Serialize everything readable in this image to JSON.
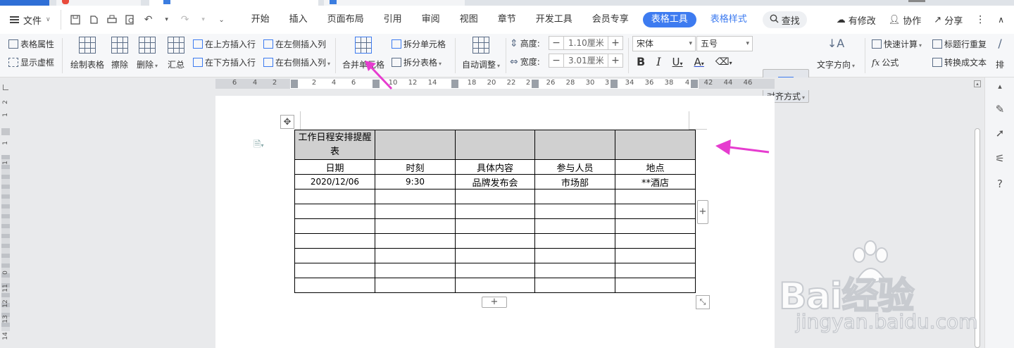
{
  "menubar": {
    "file_label": "文件",
    "menus": [
      "开始",
      "插入",
      "页面布局",
      "引用",
      "审阅",
      "视图",
      "章节",
      "开发工具",
      "会员专享"
    ],
    "active_tab": "表格工具",
    "style_tab": "表格样式",
    "search_label": "查找",
    "right": {
      "modified": "有修改",
      "collab": "协作",
      "share": "分享"
    }
  },
  "ribbon": {
    "table_props": "表格属性",
    "show_grid": "显示虚框",
    "draw_table": "绘制表格",
    "erase": "擦除",
    "delete": "删除",
    "summary": "汇总",
    "insert_above": "在上方插入行",
    "insert_below": "在下方插入行",
    "insert_left": "在左侧插入列",
    "insert_right": "在右侧插入列",
    "merge_cells": "合并单元格",
    "split_cells": "拆分单元格",
    "split_table": "拆分表格",
    "auto_fit": "自动调整",
    "height_label": "高度:",
    "height_value": "1.10厘米",
    "width_label": "宽度:",
    "width_value": "3.01厘米",
    "font_name": "宋体",
    "font_size": "五号",
    "align": "对齐方式",
    "text_dir": "文字方向",
    "quick_calc": "快速计算",
    "formula": "公式",
    "repeat_header": "标题行重复",
    "to_text": "转换成文本",
    "sort_partial": "排"
  },
  "ruler": {
    "labels": [
      "6",
      "4",
      "2",
      "2",
      "4",
      "6",
      "10",
      "12",
      "14",
      "18",
      "20",
      "22",
      "2",
      "26",
      "28",
      "30",
      "3",
      "34",
      "36",
      "38",
      "4",
      "42",
      "44",
      "46"
    ]
  },
  "vruler": {
    "labels": [
      "2",
      "1",
      "1",
      "1",
      "0",
      "11",
      "12",
      "13",
      "14"
    ]
  },
  "table": {
    "title": "工作日程安排提醒表",
    "headers": [
      "日期",
      "时刻",
      "具体内容",
      "参与人员",
      "地点"
    ],
    "rows": [
      [
        "2020/12/06",
        "9:30",
        "品牌发布会",
        "市场部",
        "**酒店"
      ],
      [
        "",
        "",
        "",
        "",
        ""
      ],
      [
        "",
        "",
        "",
        "",
        ""
      ],
      [
        "",
        "",
        "",
        "",
        ""
      ],
      [
        "",
        "",
        "",
        "",
        ""
      ],
      [
        "",
        "",
        "",
        "",
        ""
      ],
      [
        "",
        "",
        "",
        "",
        ""
      ],
      [
        "",
        "",
        "",
        "",
        ""
      ]
    ]
  },
  "icons": {
    "undo": "undo-icon",
    "redo": "redo-icon",
    "save": "save-icon",
    "print": "print-icon"
  },
  "watermark": {
    "brand": "Bai经验",
    "url": "jingyan.baidu.com"
  },
  "colors": {
    "accent": "#3d7bf0",
    "arrow": "#e63ccf",
    "header_fill": "#d0d0d0"
  }
}
